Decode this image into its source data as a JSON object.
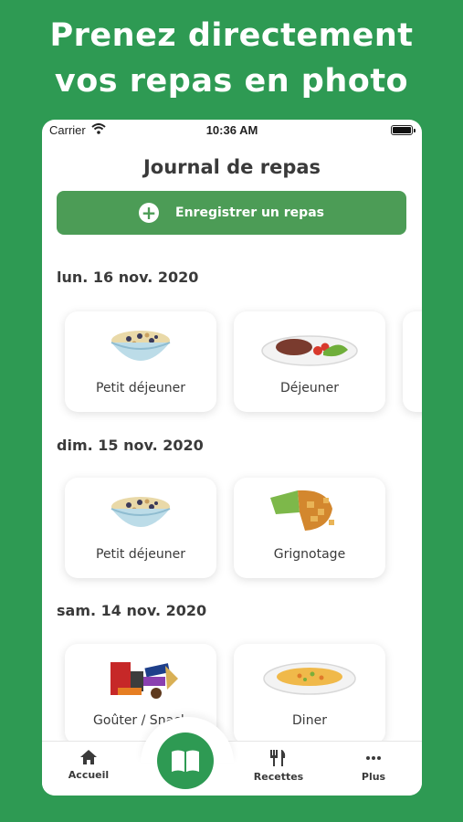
{
  "promo": {
    "line1": "Prenez directement",
    "line2": "vos repas en photo"
  },
  "status_bar": {
    "carrier": "Carrier",
    "time": "10:36 AM"
  },
  "header": {
    "title": "Journal de repas"
  },
  "record_button": {
    "label": "Enregistrer un repas"
  },
  "days": [
    {
      "date": "lun. 16 nov. 2020",
      "meals": [
        {
          "label": "Petit déjeuner",
          "icon": "cereal-bowl-icon"
        },
        {
          "label": "Déjeuner",
          "icon": "steak-plate-icon"
        }
      ]
    },
    {
      "date": "dim. 15 nov. 2020",
      "meals": [
        {
          "label": "Petit déjeuner",
          "icon": "cereal-bowl-icon"
        },
        {
          "label": "Grignotage",
          "icon": "chips-bag-icon"
        }
      ]
    },
    {
      "date": "sam. 14 nov. 2020",
      "meals": [
        {
          "label": "Goûter / Snack",
          "icon": "snacks-icon"
        },
        {
          "label": "Diner",
          "icon": "soup-plate-icon"
        }
      ]
    }
  ],
  "tabbar": {
    "home": "Accueil",
    "recipes": "Recettes",
    "more": "Plus"
  },
  "colors": {
    "background": "#2e9a53",
    "accent": "#4c9c56",
    "text": "#3a3a3a"
  }
}
